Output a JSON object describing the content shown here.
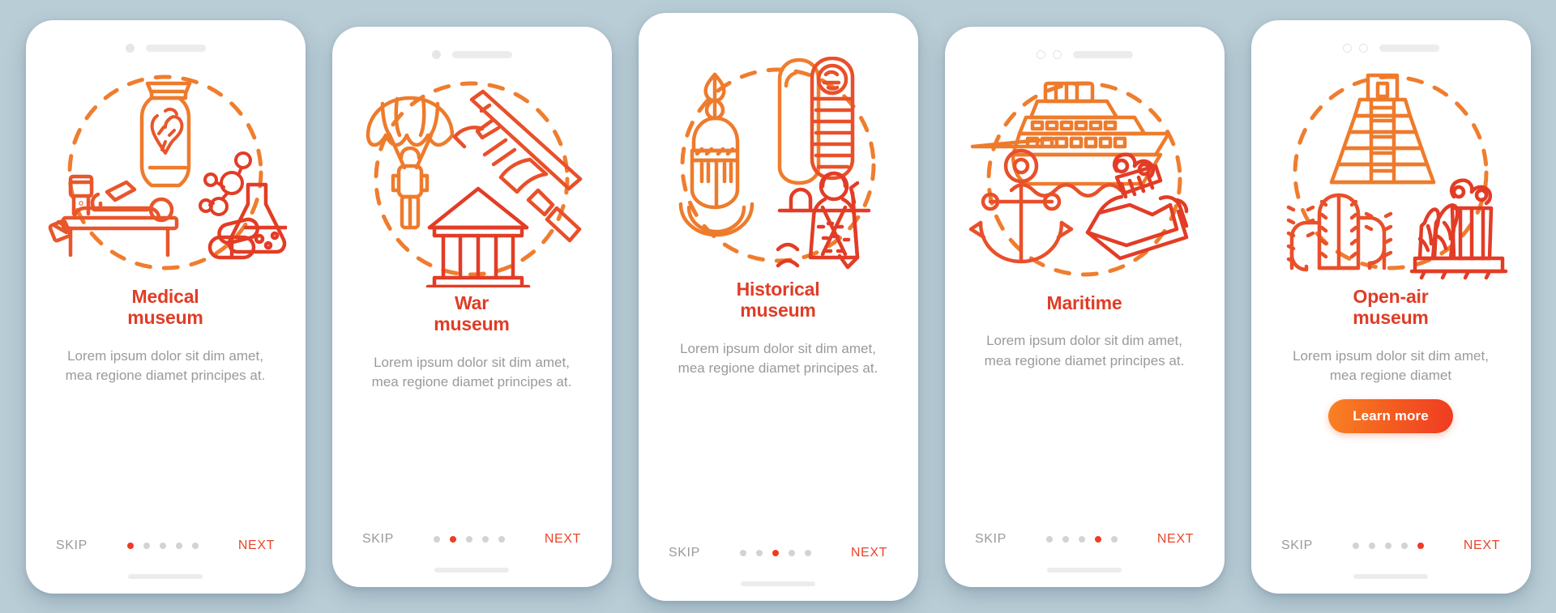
{
  "background_color": "#b9cdd6",
  "theme": {
    "title_color": "#e03c26",
    "body_text_color": "#9a9a9a",
    "accent_color": "#ee3c22",
    "next_color": "#e8452b",
    "dot_inactive_color": "#d3d3d3",
    "button_gradient_from": "#f98224",
    "button_gradient_to": "#ef3b23"
  },
  "nav_labels": {
    "skip": "SKIP",
    "next": "NEXT"
  },
  "screens": [
    {
      "id": "medical-museum",
      "title_line1": "Medical",
      "title_line2": "museum",
      "description": "Lorem ipsum dolor sit dim amet, mea regione diamet principes at.",
      "active_dot": 1,
      "dot_count": 5,
      "notch_style": "dot-and-speaker",
      "has_learn_more": false,
      "learn_more_label": "",
      "icons": [
        "heart-in-jar-icon",
        "autopsy-table-icon",
        "molecule-icon",
        "flask-icon",
        "pills-icon",
        "dashed-circle-icon"
      ]
    },
    {
      "id": "war-museum",
      "title_line1": "War",
      "title_line2": "museum",
      "description": "Lorem ipsum dolor sit dim amet, mea regione diamet principes at.",
      "active_dot": 2,
      "dot_count": 5,
      "notch_style": "dot-and-speaker",
      "has_learn_more": false,
      "learn_more_label": "",
      "icons": [
        "parachutist-icon",
        "rifle-icon",
        "museum-building-icon",
        "dashed-circle-icon"
      ]
    },
    {
      "id": "historical-museum",
      "title_line1": "Historical",
      "title_line2": "museum",
      "description": "Lorem ipsum dolor sit dim amet, mea regione diamet principes at.",
      "active_dot": 3,
      "dot_count": 5,
      "notch_style": "none",
      "has_learn_more": false,
      "learn_more_label": "",
      "icons": [
        "knight-helmet-icon",
        "mummy-sarcophagus-icon",
        "tribal-warrior-icon",
        "dashed-circle-icon"
      ]
    },
    {
      "id": "maritime",
      "title_line1": "Maritime",
      "title_line2": "",
      "description": "Lorem ipsum dolor sit dim amet, mea regione diamet principes at.",
      "active_dot": 4,
      "dot_count": 5,
      "notch_style": "two-rings-and-speaker",
      "has_learn_more": false,
      "learn_more_label": "",
      "icons": [
        "cruise-ship-icon",
        "anchor-icon",
        "underwater-ruins-icon",
        "dashed-circle-icon"
      ]
    },
    {
      "id": "open-air-museum",
      "title_line1": "Open-air",
      "title_line2": "museum",
      "description": "Lorem ipsum dolor sit dim amet, mea regione diamet",
      "active_dot": 5,
      "dot_count": 5,
      "notch_style": "two-rings-and-speaker",
      "has_learn_more": true,
      "learn_more_label": "Learn more",
      "icons": [
        "mayan-pyramid-icon",
        "cactus-icon",
        "ancient-columns-icon",
        "dashed-circle-icon"
      ]
    }
  ]
}
